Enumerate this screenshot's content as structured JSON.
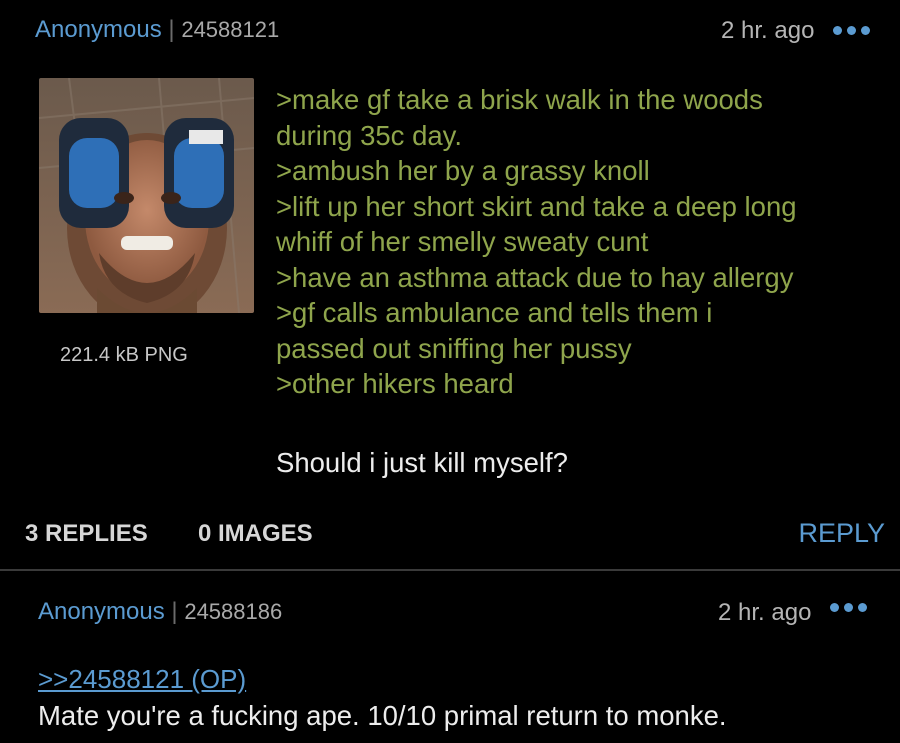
{
  "post": {
    "name": "Anonymous",
    "separator": "|",
    "post_id": "24588121",
    "time": "2 hr. ago",
    "file_info": "221.4 kB PNG",
    "lines": [
      ">make gf take a brisk walk in the woods",
      "during 35c day.",
      ">ambush her by a grassy knoll",
      ">lift up her short skirt and take a deep long",
      "whiff of her smelly sweaty cunt",
      ">have an asthma attack due to hay allergy",
      ">gf calls ambulance and tells them i",
      "passed out sniffing her pussy",
      ">other hikers heard"
    ],
    "question": "Should i just kill myself?",
    "replies_count": "3 REPLIES",
    "images_count": "0 IMAGES",
    "reply_label": "REPLY"
  },
  "reply": {
    "name": "Anonymous",
    "separator": "|",
    "post_id": "24588186",
    "time": "2 hr. ago",
    "quote": ">>24588121 (OP)",
    "text": "Mate you're a fucking ape. 10/10 primal return to monke."
  },
  "colors": {
    "background": "#000000",
    "name_blue": "#5b9bd1",
    "greentext": "#8fa54c",
    "divider": "#3a3a3a"
  },
  "icons": {
    "more": "more-options-icon",
    "thumbnail": "post-image-thumbnail"
  }
}
